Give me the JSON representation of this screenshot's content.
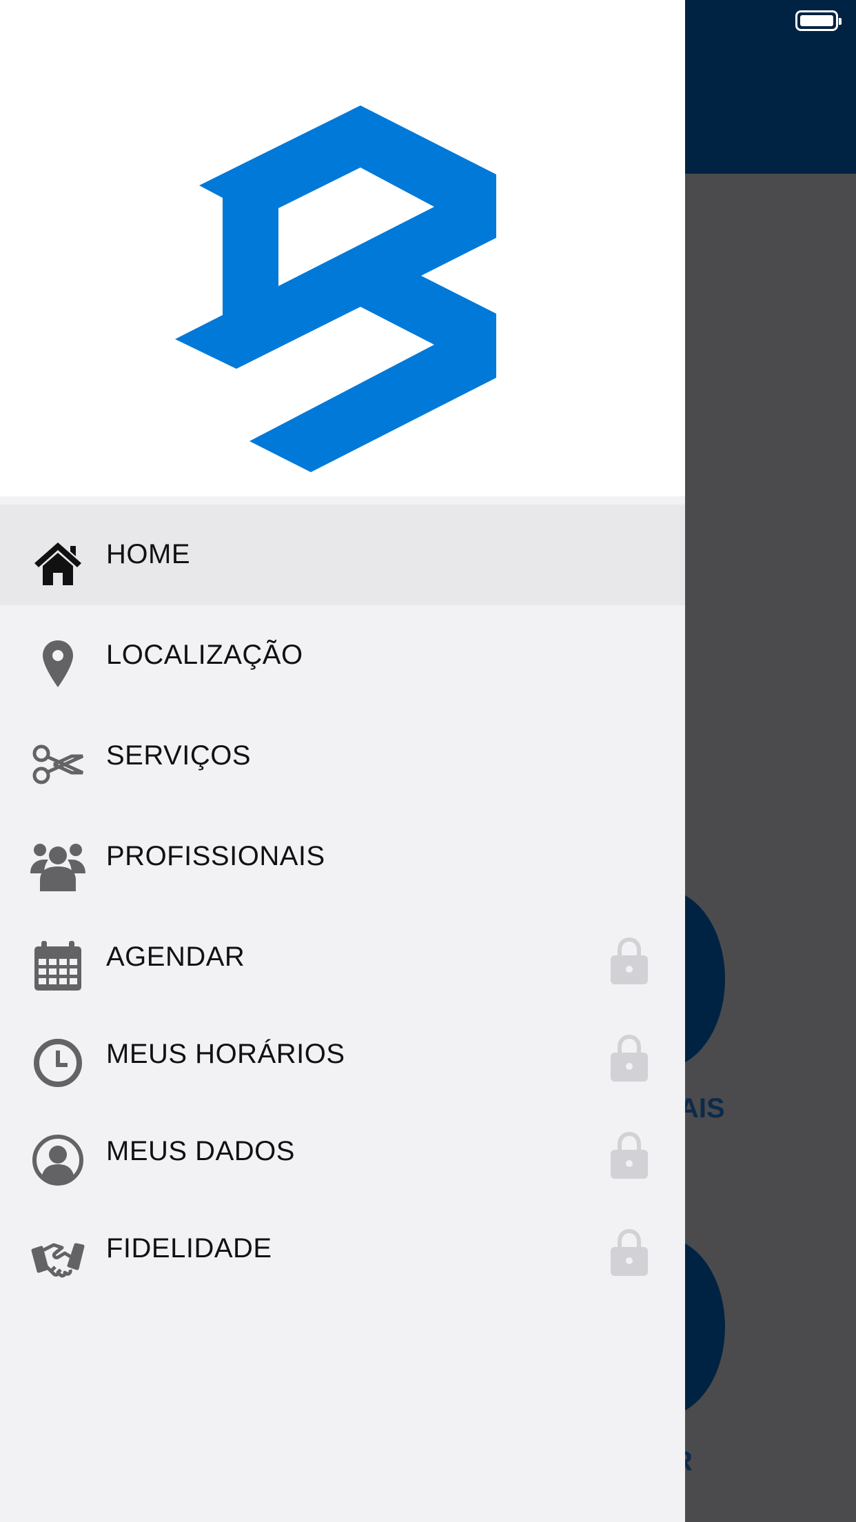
{
  "background": {
    "label_1": "AIS",
    "label_2": "R"
  },
  "drawer": {
    "logo_color": "#0079d8",
    "menu": [
      {
        "label": "HOME",
        "icon": "home-icon",
        "locked": false,
        "active": true
      },
      {
        "label": "LOCALIZAÇÃO",
        "icon": "map-pin-icon",
        "locked": false,
        "active": false
      },
      {
        "label": "SERVIÇOS",
        "icon": "scissors-icon",
        "locked": false,
        "active": false
      },
      {
        "label": "PROFISSIONAIS",
        "icon": "users-icon",
        "locked": false,
        "active": false
      },
      {
        "label": "AGENDAR",
        "icon": "calendar-icon",
        "locked": true,
        "active": false
      },
      {
        "label": "MEUS HORÁRIOS",
        "icon": "clock-icon",
        "locked": true,
        "active": false
      },
      {
        "label": "MEUS DADOS",
        "icon": "user-circle-icon",
        "locked": true,
        "active": false
      },
      {
        "label": "FIDELIDADE",
        "icon": "handshake-icon",
        "locked": true,
        "active": false
      }
    ]
  }
}
